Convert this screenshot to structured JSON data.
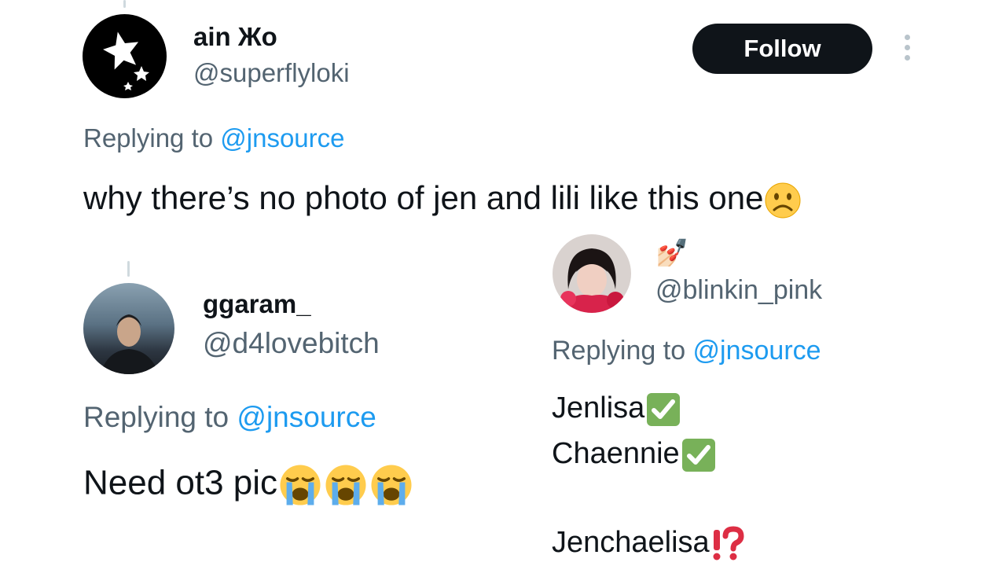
{
  "tweets": [
    {
      "display_name": "ain Жo",
      "handle": "@superflyloki",
      "replying_prefix": "Replying to ",
      "replying_mention": "@jnsource",
      "text": "why there’s no photo of jen and lili like this one",
      "follow_label": "Follow"
    },
    {
      "display_name": "ggaram_",
      "handle": "@d4lovebitch",
      "replying_prefix": "Replying to ",
      "replying_mention": "@jnsource",
      "text": "Need ot3 pic"
    },
    {
      "display_name": "💅🏻",
      "handle": "@blinkin_pink",
      "replying_prefix": "Replying to ",
      "replying_mention": "@jnsource",
      "lines": [
        "Jenlisa",
        "Chaennie",
        "",
        "Jenchaelisa"
      ]
    }
  ],
  "colors": {
    "accent": "#1d9bf0",
    "secondary_text": "#536471",
    "button": "#0f1419"
  },
  "icons": [
    "star-avatar-icon",
    "more-options-icon",
    "frowning-face-emoji",
    "loudly-crying-face-emoji",
    "check-mark-emoji",
    "exclamation-question-emoji"
  ]
}
